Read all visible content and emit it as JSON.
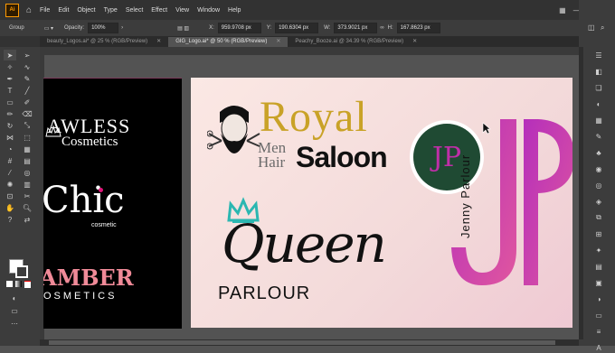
{
  "menubar": {
    "app_logo": "Ai",
    "items": [
      "File",
      "Edit",
      "Object",
      "Type",
      "Select",
      "Effect",
      "View",
      "Window",
      "Help"
    ]
  },
  "options": {
    "group_label": "Group",
    "opacity_label": "Opacity:",
    "opacity_value": "100%",
    "x_label": "X:",
    "x_value": "959.9708 px",
    "y_label": "Y:",
    "y_value": "190.6304 px",
    "w_label": "W:",
    "w_value": "373.9021 px",
    "h_label": "H:",
    "h_value": "167.8623 px"
  },
  "tabs": [
    {
      "label": "beauty_Logos.ai* @ 25 % (RGB/Preview)",
      "active": false
    },
    {
      "label": "GIG_Logo.ai* @ 50 % (RGB/Preview)",
      "active": true
    },
    {
      "label": "Peachy_Booze.ai @ 34.39 % (RGB/Preview)",
      "active": false
    }
  ],
  "artboard_left": {
    "flawless_top": "AWLESS",
    "flawless_bottom": "Cosmetics",
    "chic": "Chic",
    "chic_sub": "cosmetic",
    "amber": "AMBER",
    "amber_sub": "OSMETICS"
  },
  "artboard_main": {
    "royal": "Royal",
    "men": "Men",
    "hair": "Hair",
    "saloon": "Saloon",
    "queen": "Queen",
    "parlour": "PARLOUR",
    "jp_badge": "JP",
    "jenny": "Jenny Parlour",
    "big_jp": "JP"
  },
  "colors": {
    "royal_gold": "#c9a227",
    "badge_green": "#1f4a33",
    "magenta": "#c02ea8",
    "chic_pink": "#e0157a",
    "amber_pink": "#f08a98",
    "teal": "#2bb7b1"
  }
}
